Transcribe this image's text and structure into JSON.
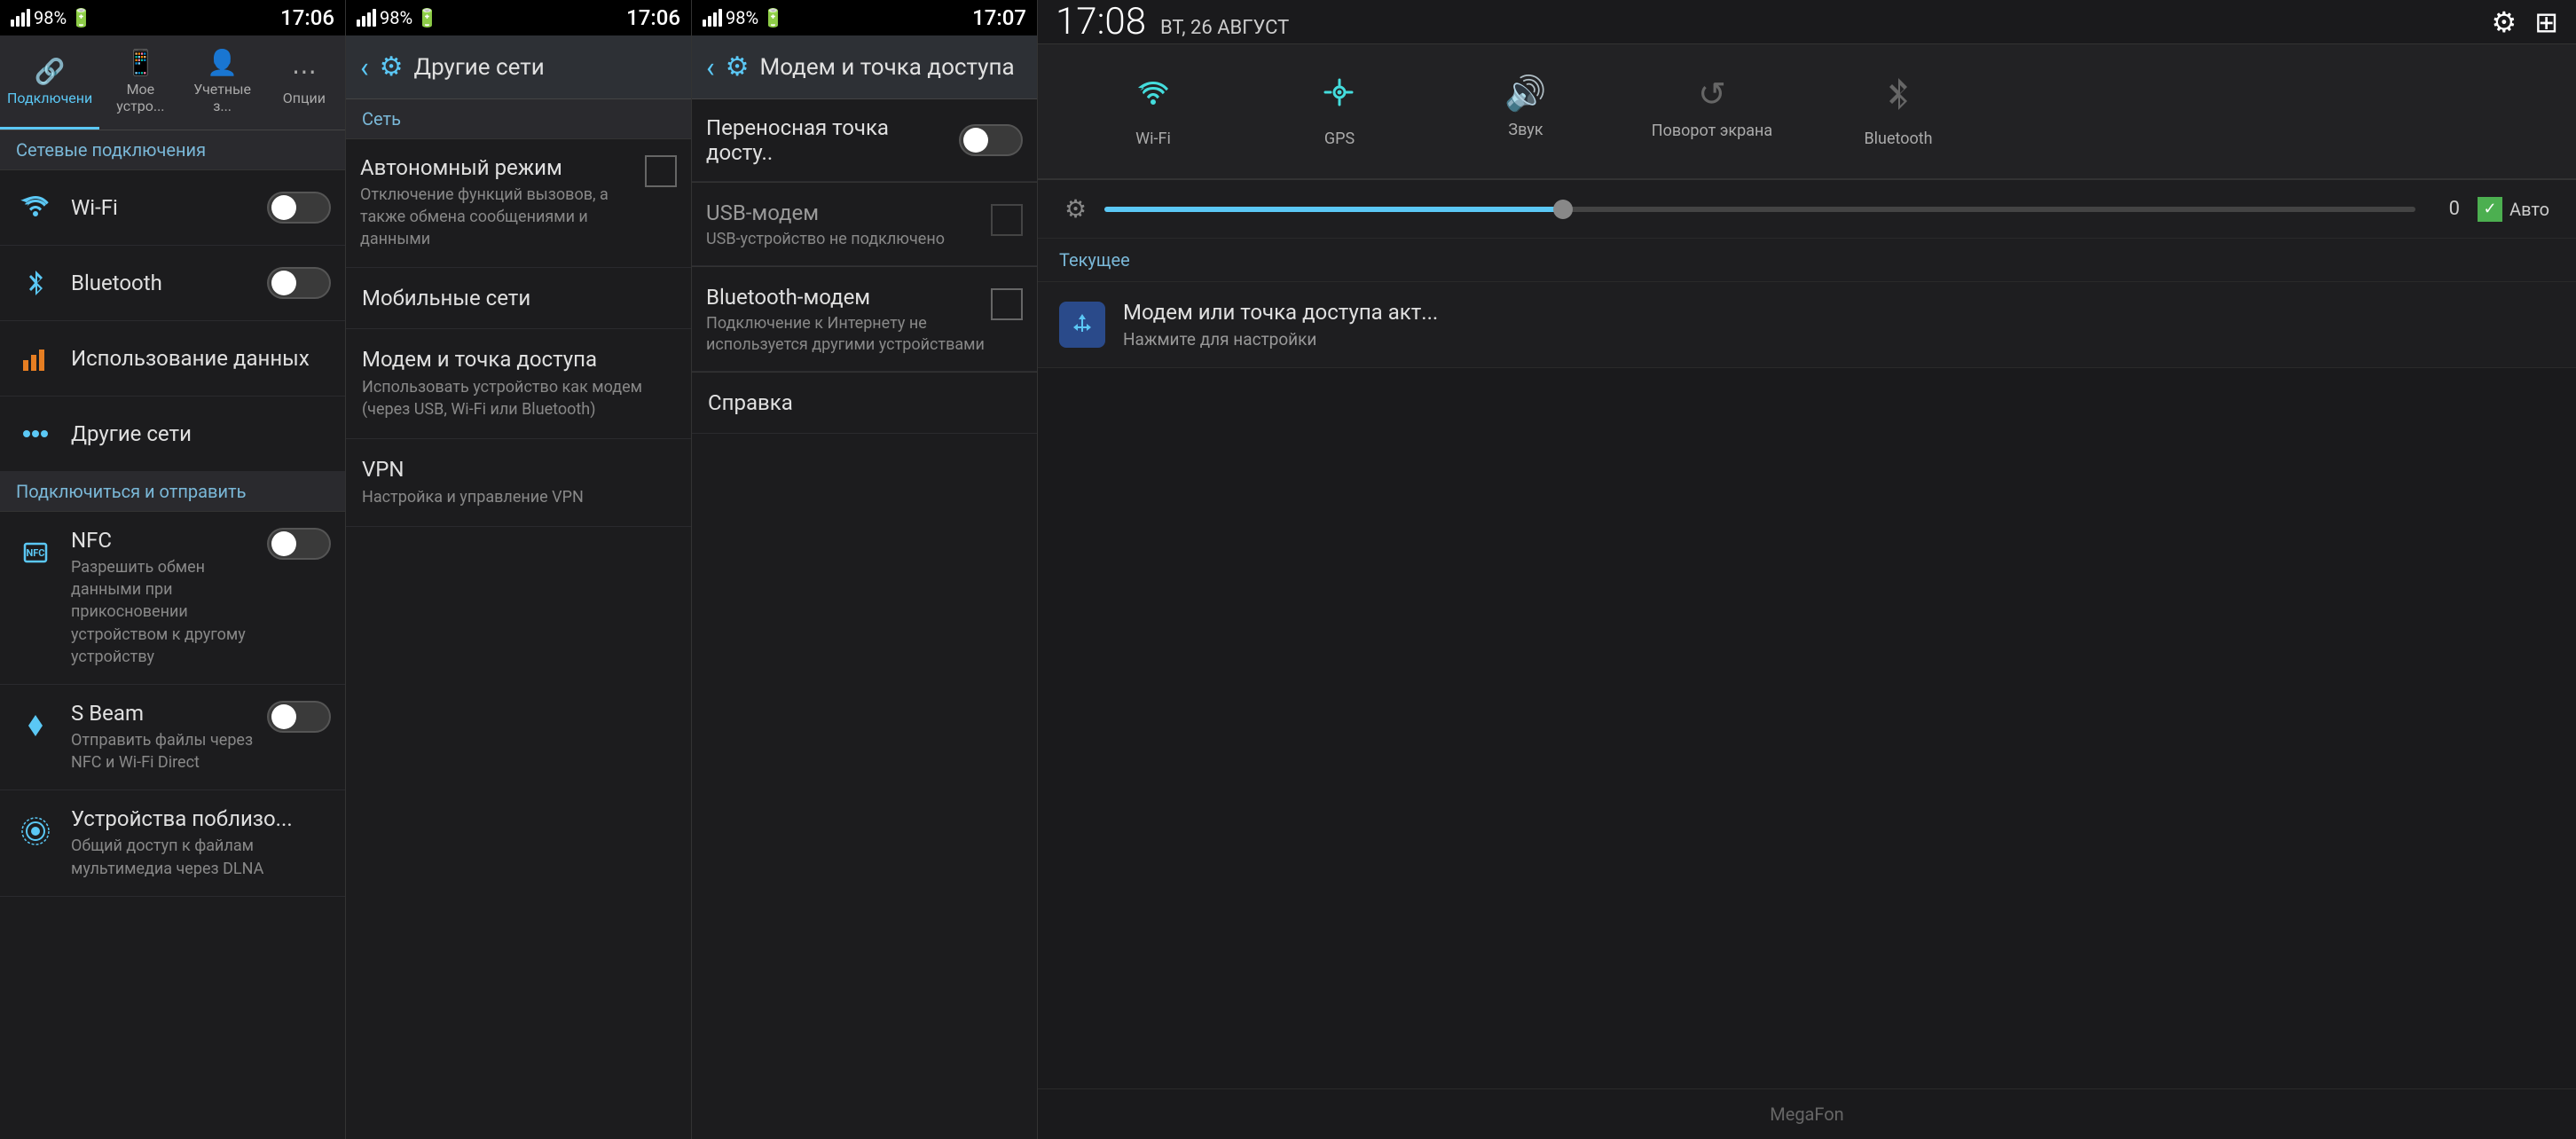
{
  "panels": {
    "panel1": {
      "statusBar": {
        "signal": "98%",
        "time": "17:06",
        "batteryLevel": 98
      },
      "tabs": [
        {
          "id": "connections",
          "label": "Подключени",
          "icon": "🔗",
          "active": true
        },
        {
          "id": "mydevice",
          "label": "Мое устро...",
          "icon": "📱",
          "active": false
        },
        {
          "id": "accounts",
          "label": "Учетные з...",
          "icon": "👤",
          "active": false
        },
        {
          "id": "options",
          "label": "Опции",
          "icon": "⋯",
          "active": false
        }
      ],
      "sectionHeader": "Сетевые подключения",
      "items": [
        {
          "id": "wifi",
          "icon": "wifi",
          "title": "Wi-Fi",
          "subtitle": "",
          "hasToggle": true,
          "toggleState": "off"
        },
        {
          "id": "bluetooth",
          "icon": "bluetooth",
          "title": "Bluetooth",
          "subtitle": "",
          "hasToggle": true,
          "toggleState": "off"
        },
        {
          "id": "data-usage",
          "icon": "data",
          "title": "Использование данных",
          "subtitle": "",
          "hasToggle": false,
          "toggleState": ""
        },
        {
          "id": "other-networks",
          "icon": "other",
          "title": "Другие сети",
          "subtitle": "",
          "hasToggle": false,
          "toggleState": ""
        }
      ],
      "connectSection": "Подключиться и отправить",
      "connectItems": [
        {
          "id": "nfc",
          "icon": "nfc",
          "title": "NFC",
          "subtitle": "Разрешить обмен данными при прикосновении устройством к другому устройству",
          "hasToggle": true,
          "toggleState": "off"
        },
        {
          "id": "sbeam",
          "icon": "sbeam",
          "title": "S Beam",
          "subtitle": "Отправить файлы через NFC и Wi-Fi Direct",
          "hasToggle": true,
          "toggleState": "off"
        },
        {
          "id": "nearby",
          "icon": "nearby",
          "title": "Устройства поблизо...",
          "subtitle": "Общий доступ к файлам мультимедиа через DLNA",
          "hasToggle": false,
          "toggleState": ""
        }
      ]
    },
    "panel2": {
      "statusBar": {
        "signal": "98%",
        "time": "17:06"
      },
      "header": {
        "title": "Другие сети",
        "icon": "⚙"
      },
      "sectionLabel": "Сеть",
      "items": [
        {
          "id": "airplane",
          "title": "Автономный режим",
          "subtitle": "Отключение функций вызовов, а также обмена сообщениями и данными",
          "hasCheckbox": true
        },
        {
          "id": "mobile-networks",
          "title": "Мобильные сети",
          "subtitle": "",
          "hasCheckbox": false
        },
        {
          "id": "tethering",
          "title": "Модем и точка доступа",
          "subtitle": "Использовать устройство как модем (через USB, Wi-Fi или Bluetooth)",
          "hasCheckbox": false
        },
        {
          "id": "vpn",
          "title": "VPN",
          "subtitle": "Настройка и управление VPN",
          "hasCheckbox": false
        }
      ]
    },
    "panel3": {
      "statusBar": {
        "signal": "98%",
        "time": "17:07"
      },
      "header": {
        "title": "Модем и точка доступа",
        "icon": "⚙"
      },
      "items": [
        {
          "id": "portable-hotspot",
          "title": "Переносная точка досту..",
          "subtitle": "",
          "hasToggle": true,
          "toggleState": "off"
        },
        {
          "id": "usb-modem",
          "title": "USB-модем",
          "subtitle": "USB-устройство не подключено",
          "hasCheckbox": true,
          "checked": false,
          "disabled": true
        },
        {
          "id": "bluetooth-modem",
          "title": "Bluetooth-модем",
          "subtitle": "Подключение к Интернету не используется другими устройствами",
          "hasCheckbox": true,
          "checked": false
        },
        {
          "id": "help",
          "title": "Справка",
          "subtitle": "",
          "hasCheckbox": false
        }
      ]
    },
    "panel4": {
      "statusBar": {
        "time": "17:08",
        "date": "ВТ, 26 АВГУСТ"
      },
      "quickSettings": [
        {
          "id": "wifi",
          "icon": "wifi",
          "label": "Wi-Fi",
          "active": true
        },
        {
          "id": "gps",
          "icon": "gps",
          "label": "GPS",
          "active": true
        },
        {
          "id": "sound",
          "icon": "sound",
          "label": "Звук",
          "active": true
        },
        {
          "id": "rotate",
          "icon": "rotate",
          "label": "Поворот экрана",
          "active": false
        },
        {
          "id": "bluetooth",
          "icon": "bluetooth",
          "label": "Bluetooth",
          "active": false
        }
      ],
      "brightnessSlider": {
        "value": "0",
        "autoLabel": "Авто",
        "fillPercent": 35
      },
      "currentSection": "Текущее",
      "notifications": [
        {
          "id": "tethering-notif",
          "icon": "usb",
          "title": "Модем или точка доступа акт...",
          "subtitle": "Нажмите для настройки"
        }
      ],
      "carrier": "MegaFon"
    }
  }
}
